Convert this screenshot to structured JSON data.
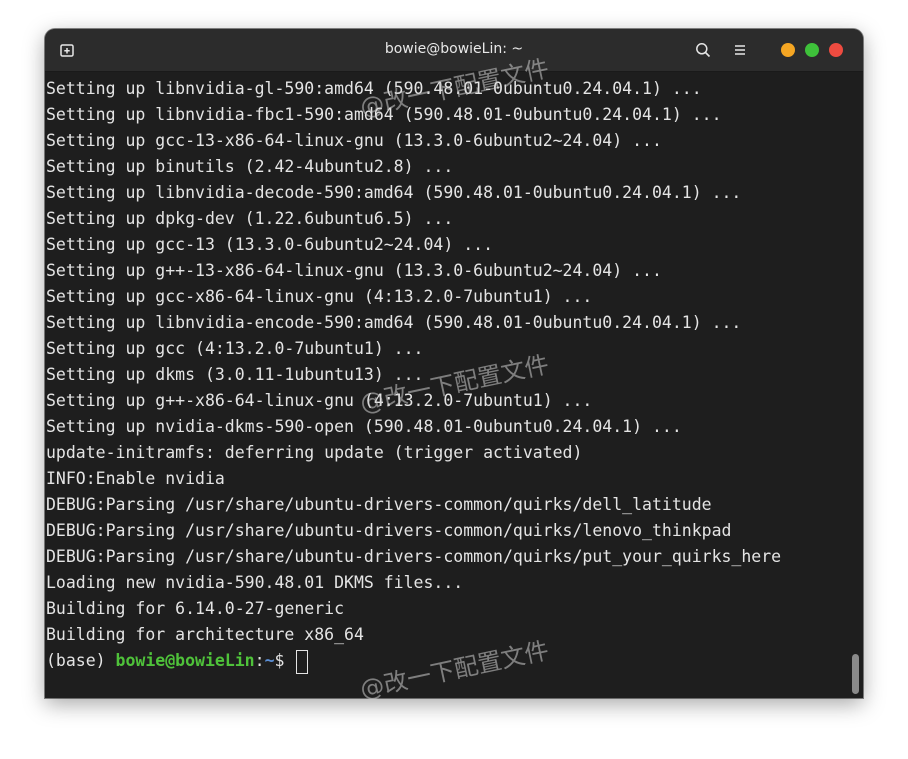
{
  "window": {
    "title": "bowie@bowieLin: ~",
    "icons": {
      "new_tab": "new-tab-icon",
      "search": "search-icon",
      "menu": "hamburger-menu-icon"
    },
    "controls": {
      "minimize_color": "#f5a623",
      "maximize_color": "#3ec13a",
      "close_color": "#ee4b40"
    }
  },
  "terminal": {
    "lines": [
      "Setting up libnvidia-gl-590:amd64 (590.48.01-0ubuntu0.24.04.1) ...",
      "Setting up libnvidia-fbc1-590:amd64 (590.48.01-0ubuntu0.24.04.1) ...",
      "Setting up gcc-13-x86-64-linux-gnu (13.3.0-6ubuntu2~24.04) ...",
      "Setting up binutils (2.42-4ubuntu2.8) ...",
      "Setting up libnvidia-decode-590:amd64 (590.48.01-0ubuntu0.24.04.1) ...",
      "Setting up dpkg-dev (1.22.6ubuntu6.5) ...",
      "Setting up gcc-13 (13.3.0-6ubuntu2~24.04) ...",
      "Setting up g++-13-x86-64-linux-gnu (13.3.0-6ubuntu2~24.04) ...",
      "Setting up gcc-x86-64-linux-gnu (4:13.2.0-7ubuntu1) ...",
      "Setting up libnvidia-encode-590:amd64 (590.48.01-0ubuntu0.24.04.1) ...",
      "Setting up gcc (4:13.2.0-7ubuntu1) ...",
      "Setting up dkms (3.0.11-1ubuntu13) ...",
      "Setting up g++-x86-64-linux-gnu (4:13.2.0-7ubuntu1) ...",
      "Setting up nvidia-dkms-590-open (590.48.01-0ubuntu0.24.04.1) ...",
      "update-initramfs: deferring update (trigger activated)",
      "INFO:Enable nvidia",
      "DEBUG:Parsing /usr/share/ubuntu-drivers-common/quirks/dell_latitude",
      "DEBUG:Parsing /usr/share/ubuntu-drivers-common/quirks/lenovo_thinkpad",
      "DEBUG:Parsing /usr/share/ubuntu-drivers-common/quirks/put_your_quirks_here",
      "Loading new nvidia-590.48.01 DKMS files...",
      "Building for 6.14.0-27-generic",
      "Building for architecture x86_64"
    ],
    "prompt": {
      "env": "(base) ",
      "user_host": "bowie@bowieLin",
      "colon": ":",
      "path": "~",
      "symbol": "$ "
    },
    "text_color": "#e4e4e4",
    "user_color": "#4fc23a",
    "path_color": "#5b8fd6",
    "background": "#1e1e1e"
  },
  "watermark": {
    "text": "@改一下配置文件"
  }
}
